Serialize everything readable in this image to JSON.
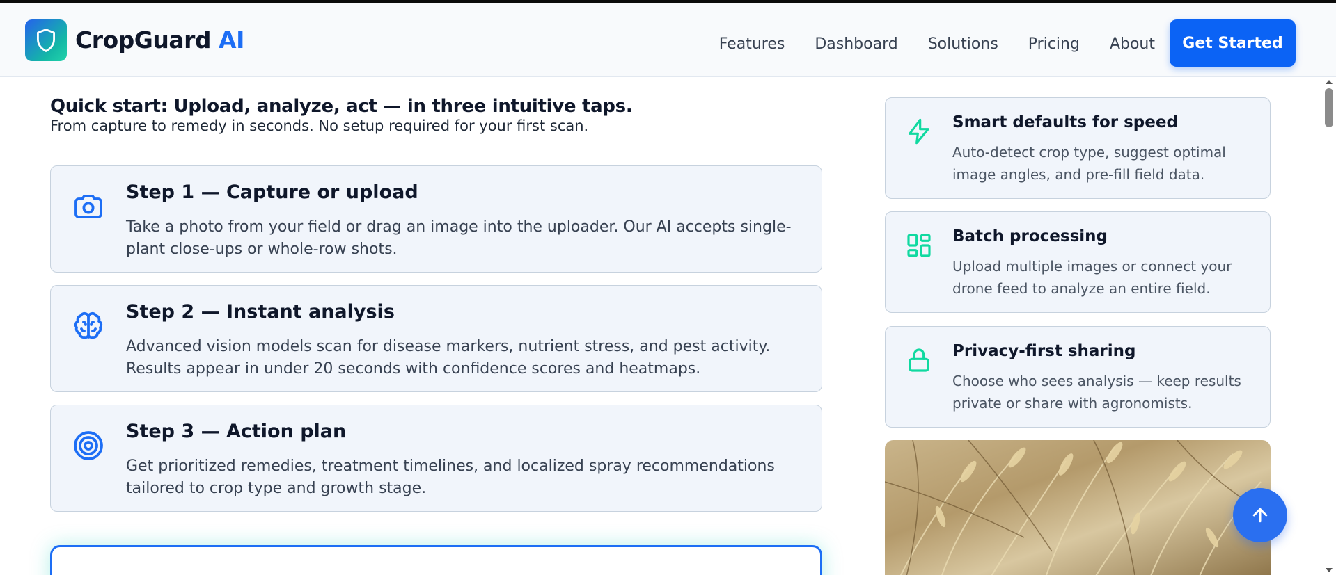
{
  "header": {
    "brand_main": "CropGuard",
    "brand_accent": "AI",
    "nav": [
      "Features",
      "Dashboard",
      "Solutions",
      "Pricing",
      "About"
    ],
    "cta_label": "Get Started"
  },
  "quickstart": {
    "title": "Quick start: Upload, analyze, act — in three intuitive taps.",
    "subtitle": "From capture to remedy in seconds. No setup required for your first scan."
  },
  "steps": [
    {
      "icon": "camera-icon",
      "title": "Step 1 — Capture or upload",
      "text": "Take a photo from your field or drag an image into the uploader. Our AI accepts single-plant close-ups or whole-row shots."
    },
    {
      "icon": "brain-icon",
      "title": "Step 2 — Instant analysis",
      "text": "Advanced vision models scan for disease markers, nutrient stress, and pest activity. Results appear in under 20 seconds with confidence scores and heatmaps."
    },
    {
      "icon": "target-icon",
      "title": "Step 3 — Action plan",
      "text": "Get prioritized remedies, treatment timelines, and localized spray recommendations tailored to crop type and growth stage."
    }
  ],
  "features": [
    {
      "icon": "lightning-icon",
      "title": "Smart defaults for speed",
      "text": "Auto-detect crop type, suggest optimal image angles, and pre-fill field data."
    },
    {
      "icon": "grid-icon",
      "title": "Batch processing",
      "text": "Upload multiple images or connect your drone feed to analyze an entire field."
    },
    {
      "icon": "lock-icon",
      "title": "Privacy-first sharing",
      "text": "Choose who sees analysis — keep results private or share with agronomists."
    }
  ],
  "colors": {
    "brand": "#1d6ef5",
    "accent_icon": "#10d9a0",
    "step_icon": "#1d6ef5"
  }
}
